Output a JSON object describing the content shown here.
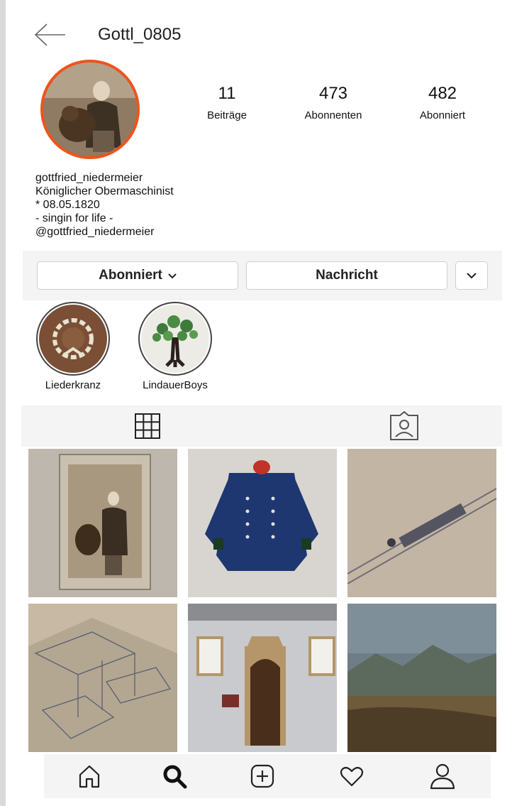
{
  "header": {
    "username": "Gottl_0805",
    "back_icon": "arrow-left-icon"
  },
  "profile": {
    "stats": [
      {
        "value": "11",
        "label": "Beiträge"
      },
      {
        "value": "473",
        "label": "Abonnenten"
      },
      {
        "value": "482",
        "label": "Abonniert"
      }
    ],
    "bio": [
      "gottfried_niedermeier",
      "Königlicher Obermaschinist",
      "* 08.05.1820",
      "- singin for life -",
      "@gottfried_niedermeier"
    ],
    "avatar_ring_color": "#f0531c"
  },
  "actions": {
    "follow_label": "Abonniert",
    "message_label": "Nachricht",
    "more_icon": "chevron-down-icon"
  },
  "highlights": [
    {
      "label": "Liederkranz"
    },
    {
      "label": "LindauerBoys"
    }
  ],
  "tabs": [
    {
      "icon": "grid-icon"
    },
    {
      "icon": "tagged-icon"
    }
  ],
  "nav": [
    {
      "icon": "home-icon"
    },
    {
      "icon": "search-icon"
    },
    {
      "icon": "add-post-icon"
    },
    {
      "icon": "heart-icon"
    },
    {
      "icon": "profile-icon"
    }
  ]
}
